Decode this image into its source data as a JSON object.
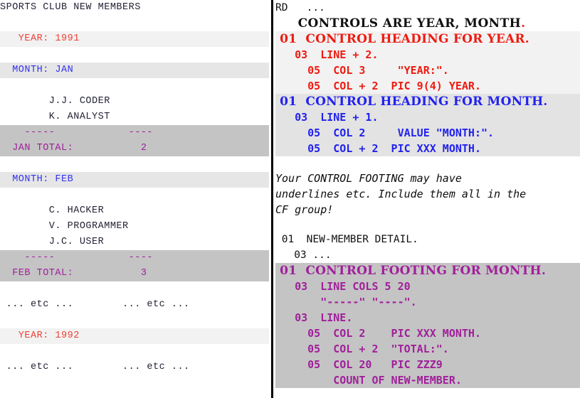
{
  "report": {
    "title": "SPORTS CLUB NEW MEMBERS",
    "lines": [
      {
        "id": "title",
        "band": "none",
        "text": "SPORTS CLUB NEW MEMBERS",
        "color": "dk"
      },
      {
        "id": "blank1",
        "band": "none",
        "text": "",
        "color": "dk"
      },
      {
        "id": "year-1991",
        "band": "light",
        "text": "   YEAR: 1991",
        "color": "red"
      },
      {
        "id": "blank2",
        "band": "none",
        "text": "",
        "color": "dk"
      },
      {
        "id": "month-jan",
        "band": "mid",
        "text": "  MONTH: JAN",
        "color": "blu"
      },
      {
        "id": "blank3",
        "band": "none",
        "text": "",
        "color": "dk"
      },
      {
        "id": "det-jan-1",
        "band": "none",
        "text": "        J.J. CODER",
        "color": "dk"
      },
      {
        "id": "det-jan-2",
        "band": "none",
        "text": "        K. ANALYST",
        "color": "dk"
      },
      {
        "id": "rule-jan",
        "band": "dark",
        "text": "    -----            ----",
        "color": "mag"
      },
      {
        "id": "tot-jan",
        "band": "dark",
        "text": "  JAN TOTAL:           2",
        "color": "mag"
      },
      {
        "id": "blank4",
        "band": "none",
        "text": "",
        "color": "dk"
      },
      {
        "id": "month-feb",
        "band": "mid",
        "text": "  MONTH: FEB",
        "color": "blu"
      },
      {
        "id": "blank5",
        "band": "none",
        "text": "",
        "color": "dk"
      },
      {
        "id": "det-feb-1",
        "band": "none",
        "text": "        C. HACKER",
        "color": "dk"
      },
      {
        "id": "det-feb-2",
        "band": "none",
        "text": "        V. PROGRAMMER",
        "color": "dk"
      },
      {
        "id": "det-feb-3",
        "band": "none",
        "text": "        J.C. USER",
        "color": "dk"
      },
      {
        "id": "rule-feb",
        "band": "dark",
        "text": "    -----            ----",
        "color": "mag"
      },
      {
        "id": "tot-feb",
        "band": "dark",
        "text": "  FEB TOTAL:           3",
        "color": "mag"
      },
      {
        "id": "blank6",
        "band": "none",
        "text": "",
        "color": "dk"
      },
      {
        "id": "etc-1",
        "band": "none",
        "text": " ... etc ...        ... etc ...",
        "color": "dk"
      },
      {
        "id": "blank7",
        "band": "none",
        "text": "",
        "color": "dk"
      },
      {
        "id": "year-1992",
        "band": "light",
        "text": "   YEAR: 1992",
        "color": "red"
      },
      {
        "id": "blank8",
        "band": "none",
        "text": "",
        "color": "dk"
      },
      {
        "id": "etc-2",
        "band": "none",
        "text": " ... etc ...        ... etc ...",
        "color": "dk"
      }
    ]
  },
  "source": {
    "lines": [
      {
        "id": "rd",
        "style": "mono",
        "block": "none",
        "text": "RD   ..."
      },
      {
        "id": "controls-are",
        "style": "bold-serif",
        "block": "none",
        "text": "     CONTROLS ARE YEAR, MONTH",
        "tail": "."
      },
      {
        "id": "ch-year",
        "style": "hdr",
        "block": "red",
        "text": " 01  CONTROL HEADING FOR YEAR."
      },
      {
        "id": "ch-year-03",
        "style": "code",
        "block": "red",
        "text": "   03  LINE + 2."
      },
      {
        "id": "ch-year-05a",
        "style": "code",
        "block": "red",
        "text": "     05  COL 3     \"YEAR:\"."
      },
      {
        "id": "ch-year-05b",
        "style": "code",
        "block": "red",
        "text": "     05  COL + 2  PIC 9(4) YEAR."
      },
      {
        "id": "ch-month",
        "style": "hdr",
        "block": "blue",
        "text": " 01  CONTROL HEADING FOR MONTH."
      },
      {
        "id": "ch-month-03",
        "style": "code",
        "block": "blue",
        "text": "   03  LINE + 1."
      },
      {
        "id": "ch-month-05a",
        "style": "code",
        "block": "blue",
        "text": "     05  COL 2     VALUE \"MONTH:\"."
      },
      {
        "id": "ch-month-05b",
        "style": "code",
        "block": "blue",
        "text": "     05  COL + 2  PIC XXX MONTH."
      },
      {
        "id": "gap-1",
        "style": "gap",
        "block": "none",
        "text": ""
      },
      {
        "id": "note-1",
        "style": "italic",
        "block": "none",
        "text": "Your CONTROL FOOTING may have"
      },
      {
        "id": "note-2",
        "style": "italic",
        "block": "none",
        "text": "underlines etc. Include them all in the"
      },
      {
        "id": "note-3",
        "style": "italic",
        "block": "none",
        "text": "CF group!"
      },
      {
        "id": "gap-2",
        "style": "gap",
        "block": "none",
        "text": ""
      },
      {
        "id": "detail-01",
        "style": "mono",
        "block": "none",
        "text": " 01  NEW-MEMBER DETAIL."
      },
      {
        "id": "detail-03",
        "style": "mono",
        "block": "none",
        "text": "   03 ..."
      },
      {
        "id": "cf-month",
        "style": "hdr",
        "block": "mag",
        "text": " 01  CONTROL FOOTING FOR MONTH."
      },
      {
        "id": "cf-03a",
        "style": "code",
        "block": "mag",
        "text": "   03  LINE COLS 5 20"
      },
      {
        "id": "cf-03a-lit",
        "style": "code",
        "block": "mag",
        "text": "       \"-----\" \"----\"."
      },
      {
        "id": "cf-03b",
        "style": "code",
        "block": "mag",
        "text": "   03  LINE."
      },
      {
        "id": "cf-05a",
        "style": "code",
        "block": "mag",
        "text": "     05  COL 2    PIC XXX MONTH."
      },
      {
        "id": "cf-05b",
        "style": "code",
        "block": "mag",
        "text": "     05  COL + 2  \"TOTAL:\"."
      },
      {
        "id": "cf-05c",
        "style": "code",
        "block": "mag",
        "text": "     05  COL 20   PIC ZZZ9"
      },
      {
        "id": "cf-05c-cont",
        "style": "code",
        "block": "mag",
        "text": "         COUNT OF NEW-MEMBER."
      }
    ]
  },
  "colors": {
    "year_red": "#ef4136",
    "month_blue": "#3333ee",
    "total_magenta": "#a0209a",
    "band_light": "#f2f2f2",
    "band_mid": "#e6e6e6",
    "band_dark": "#c4c4c4",
    "divider": "#000000",
    "text_dark": "#242436"
  }
}
